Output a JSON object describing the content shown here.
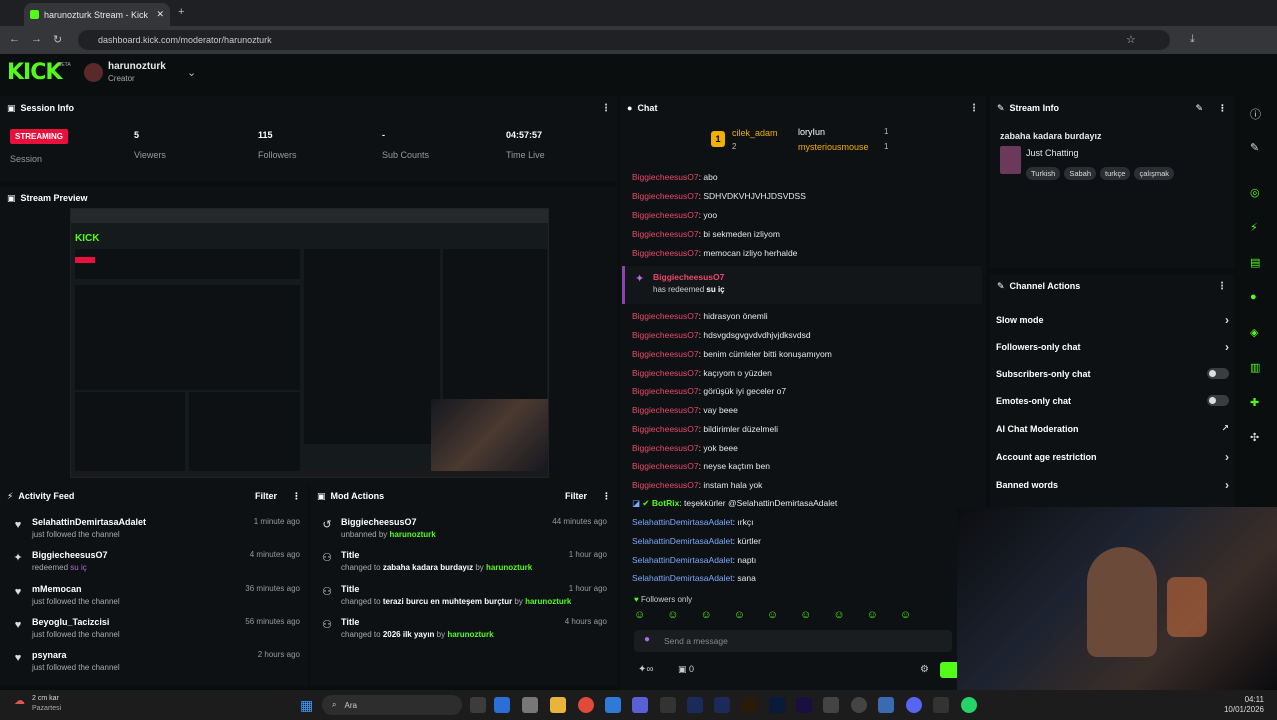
{
  "browser": {
    "tab_title": "harunozturk Stream - Kick Dash",
    "url": "dashboard.kick.com/moderator/harunozturk"
  },
  "header": {
    "logo": "KICK",
    "logo_badge": "BETA",
    "channel": "harunozturk",
    "role": "Creator"
  },
  "session": {
    "title": "Session Info",
    "status": "STREAMING",
    "status_label": "Session",
    "stats": [
      {
        "value": "5",
        "label": "Viewers"
      },
      {
        "value": "115",
        "label": "Followers"
      },
      {
        "value": "-",
        "label": "Sub Counts"
      },
      {
        "value": "04:57:57",
        "label": "Time Live"
      }
    ]
  },
  "preview": {
    "title": "Stream Preview"
  },
  "activity": {
    "title": "Activity Feed",
    "filter": "Filter",
    "rows": [
      {
        "name": "SelahattinDemirtasaAdalet",
        "sub": "just followed the channel",
        "time": "1 minute ago"
      },
      {
        "name": "BiggiecheesusO7",
        "sub": "redeemed",
        "sub2": "su iç",
        "time": "4 minutes ago"
      },
      {
        "name": "mMemocan",
        "sub": "just followed the channel",
        "time": "36 minutes ago"
      },
      {
        "name": "Beyoglu_Tacizcisi",
        "sub": "just followed the channel",
        "time": "56 minutes ago"
      },
      {
        "name": "psynara",
        "sub": "just followed the channel",
        "time": "2 hours ago"
      }
    ]
  },
  "mod": {
    "title": "Mod Actions",
    "filter": "Filter",
    "rows": [
      {
        "name": "BiggiecheesusO7",
        "pre": "unbanned by",
        "hl": "",
        "by": "harunozturk",
        "time": "44 minutes ago"
      },
      {
        "name": "Title",
        "pre": "changed to",
        "hl": "zabaha kadara burdayız",
        "by": "harunozturk",
        "time": "1 hour ago"
      },
      {
        "name": "Title",
        "pre": "changed to",
        "hl": "terazi burcu en muhteşem burçtur",
        "by": "harunozturk",
        "time": "1 hour ago"
      },
      {
        "name": "Title",
        "pre": "changed to",
        "hl": "2026 ilk yayın",
        "by": "harunozturk",
        "time": "4 hours ago"
      }
    ]
  },
  "chat": {
    "title": "Chat",
    "top": [
      {
        "name": "cilek_adam",
        "count": "2"
      },
      {
        "name": "loryIun",
        "count": "1"
      },
      {
        "name": "mysteriousmouse",
        "count": "1"
      }
    ],
    "messages": [
      {
        "u": "BiggiecheesusO7",
        "t": "abo"
      },
      {
        "u": "BiggiecheesusO7",
        "t": "SDHVDKVHJVHJDSVDSS"
      },
      {
        "u": "BiggiecheesusO7",
        "t": "yoo"
      },
      {
        "u": "BiggiecheesusO7",
        "t": "bi sekmeden izliyom"
      },
      {
        "u": "BiggiecheesusO7",
        "t": "memocan izliyo herhalde"
      }
    ],
    "redeem": {
      "user": "BiggiecheesusO7",
      "text": "has redeemed",
      "item": "su iç"
    },
    "messages2": [
      {
        "u": "BiggiecheesusO7",
        "t": "hidrasyon önemli"
      },
      {
        "u": "BiggiecheesusO7",
        "t": "hdsvgdsgvgvdvdhjvjdksvdsd"
      },
      {
        "u": "BiggiecheesusO7",
        "t": "benim cümleler bitti konuşamıyom"
      },
      {
        "u": "BiggiecheesusO7",
        "t": "kaçıyom o yüzden"
      },
      {
        "u": "BiggiecheesusO7",
        "t": "görüşük iyi geceler o7"
      },
      {
        "u": "BiggiecheesusO7",
        "t": "vay beee"
      },
      {
        "u": "BiggiecheesusO7",
        "t": "bildirimler düzelmeli"
      },
      {
        "u": "BiggiecheesusO7",
        "t": "yok beee"
      },
      {
        "u": "BiggiecheesusO7",
        "t": "neyse kaçtım ben"
      },
      {
        "u": "BiggiecheesusO7",
        "t": "instam hala yok"
      }
    ],
    "bot": {
      "u": "BotRix",
      "t": "teşekkürler @SelahattinDemirtasaAdalet"
    },
    "messages3": [
      {
        "u": "SelahattinDemirtasaAdalet",
        "t": "ırkçı"
      },
      {
        "u": "SelahattinDemirtasaAdalet",
        "t": "kürtler"
      },
      {
        "u": "SelahattinDemirtasaAdalet",
        "t": "naptı"
      },
      {
        "u": "SelahattinDemirtasaAdalet",
        "t": "sana"
      }
    ],
    "followers_only": "Followers only",
    "placeholder": "Send a message",
    "count": "0"
  },
  "stream_info": {
    "title": "Stream Info",
    "stream_title": "zabaha kadara burdayız",
    "category": "Just Chatting",
    "tags": [
      "Turkish",
      "Sabah",
      "turkçe",
      "çalışmak"
    ]
  },
  "channel_actions": {
    "title": "Channel Actions",
    "items": [
      {
        "label": "Slow mode",
        "kind": "arrow"
      },
      {
        "label": "Followers-only chat",
        "kind": "arrow"
      },
      {
        "label": "Subscribers-only chat",
        "kind": "toggle"
      },
      {
        "label": "Emotes-only chat",
        "kind": "toggle"
      },
      {
        "label": "AI Chat Moderation",
        "kind": "ext"
      },
      {
        "label": "Account age restriction",
        "kind": "arrow"
      },
      {
        "label": "Banned words",
        "kind": "arrow"
      }
    ]
  },
  "taskbar": {
    "weather": "2 cm kar",
    "weather_sub": "Pazartesi",
    "search": "Ara",
    "time": "04:11",
    "date": "10/01/2026"
  },
  "colors": {
    "accent": "#53fc18",
    "live": "#e9113c",
    "chat_user": "#e94a6a",
    "chat_user2": "#7aa9ff"
  }
}
